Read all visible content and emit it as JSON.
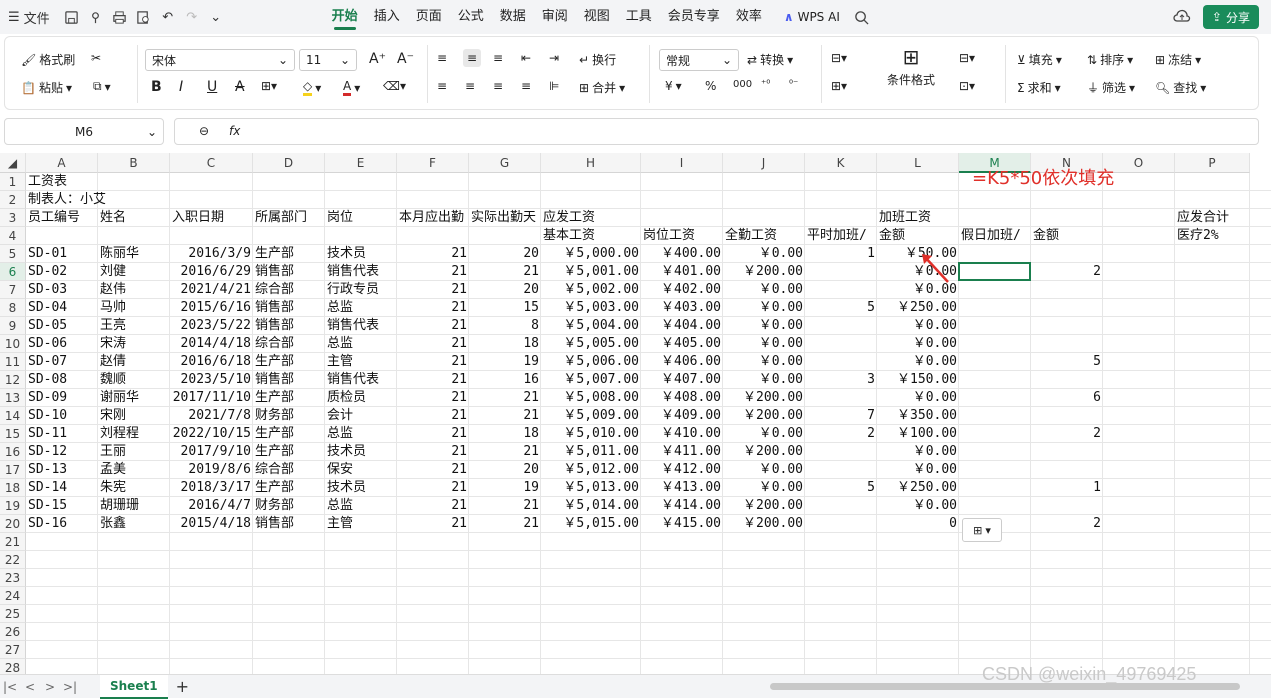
{
  "titlebar": {
    "file_label": "文件",
    "tabs": [
      "开始",
      "插入",
      "页面",
      "公式",
      "数据",
      "审阅",
      "视图",
      "工具",
      "会员专享",
      "效率"
    ],
    "wps_ai": "WPS AI",
    "share": "分享"
  },
  "ribbon": {
    "format_painter": "格式刷",
    "paste": "粘贴",
    "font_name": "宋体",
    "font_size": "11",
    "wrap": "换行",
    "merge": "合并",
    "number_format": "常规",
    "convert": "转换",
    "cond_format": "条件格式",
    "fill": "填充",
    "sort": "排序",
    "freeze": "冻结",
    "sum": "求和",
    "filter": "筛选",
    "find": "查找",
    "currency": "¥",
    "percent": "%",
    "thousands": "000"
  },
  "formula_bar": {
    "name_box": "M6",
    "fx": "fx",
    "formula": ""
  },
  "columns": [
    "A",
    "B",
    "C",
    "D",
    "E",
    "F",
    "G",
    "H",
    "I",
    "J",
    "K",
    "L",
    "M",
    "N",
    "O",
    "P"
  ],
  "rows": [
    "1",
    "2",
    "3",
    "4",
    "5",
    "6",
    "7",
    "8",
    "9",
    "10",
    "11",
    "12",
    "13",
    "14",
    "15",
    "16",
    "17",
    "18",
    "19",
    "20",
    "21",
    "22",
    "23",
    "24",
    "25",
    "26",
    "27",
    "28"
  ],
  "header": {
    "title": "工资表",
    "maker": "制表人：小艾",
    "h3": [
      "员工编号",
      "姓名",
      "入职日期",
      "所属部门",
      "岗位",
      "本月应出勤",
      "实际出勤天",
      "应发工资",
      "",
      "",
      "",
      "加班工资",
      "",
      "",
      "",
      "应发合计"
    ],
    "h4": {
      "H": "基本工资",
      "I": "岗位工资",
      "J": "全勤工资",
      "K": "平时加班/",
      "L": "金额",
      "M": "假日加班/",
      "N": "金额",
      "P": "医疗2%"
    }
  },
  "data_rows": [
    {
      "id": "SD-01",
      "name": "陈丽华",
      "date": "2016/3/9",
      "dept": "生产部",
      "post": "技术员",
      "due": "21",
      "actual": "20",
      "base": "￥5,000.00",
      "postpay": "￥400.00",
      "full": "￥0.00",
      "k": "1",
      "l": "￥50.00",
      "n": ""
    },
    {
      "id": "SD-02",
      "name": "刘健",
      "date": "2016/6/29",
      "dept": "销售部",
      "post": "销售代表",
      "due": "21",
      "actual": "21",
      "base": "￥5,001.00",
      "postpay": "￥401.00",
      "full": "￥200.00",
      "k": "",
      "l": "￥0.00",
      "n": "2"
    },
    {
      "id": "SD-03",
      "name": "赵伟",
      "date": "2021/4/21",
      "dept": "综合部",
      "post": "行政专员",
      "due": "21",
      "actual": "20",
      "base": "￥5,002.00",
      "postpay": "￥402.00",
      "full": "￥0.00",
      "k": "",
      "l": "￥0.00",
      "n": ""
    },
    {
      "id": "SD-04",
      "name": "马帅",
      "date": "2015/6/16",
      "dept": "销售部",
      "post": "总监",
      "due": "21",
      "actual": "15",
      "base": "￥5,003.00",
      "postpay": "￥403.00",
      "full": "￥0.00",
      "k": "5",
      "l": "￥250.00",
      "n": ""
    },
    {
      "id": "SD-05",
      "name": "王亮",
      "date": "2023/5/22",
      "dept": "销售部",
      "post": "销售代表",
      "due": "21",
      "actual": "8",
      "base": "￥5,004.00",
      "postpay": "￥404.00",
      "full": "￥0.00",
      "k": "",
      "l": "￥0.00",
      "n": ""
    },
    {
      "id": "SD-06",
      "name": "宋涛",
      "date": "2014/4/18",
      "dept": "综合部",
      "post": "总监",
      "due": "21",
      "actual": "18",
      "base": "￥5,005.00",
      "postpay": "￥405.00",
      "full": "￥0.00",
      "k": "",
      "l": "￥0.00",
      "n": ""
    },
    {
      "id": "SD-07",
      "name": "赵倩",
      "date": "2016/6/18",
      "dept": "生产部",
      "post": "主管",
      "due": "21",
      "actual": "19",
      "base": "￥5,006.00",
      "postpay": "￥406.00",
      "full": "￥0.00",
      "k": "",
      "l": "￥0.00",
      "n": "5"
    },
    {
      "id": "SD-08",
      "name": "魏顺",
      "date": "2023/5/10",
      "dept": "销售部",
      "post": "销售代表",
      "due": "21",
      "actual": "16",
      "base": "￥5,007.00",
      "postpay": "￥407.00",
      "full": "￥0.00",
      "k": "3",
      "l": "￥150.00",
      "n": ""
    },
    {
      "id": "SD-09",
      "name": "谢丽华",
      "date": "2017/11/10",
      "dept": "生产部",
      "post": "质检员",
      "due": "21",
      "actual": "21",
      "base": "￥5,008.00",
      "postpay": "￥408.00",
      "full": "￥200.00",
      "k": "",
      "l": "￥0.00",
      "n": "6"
    },
    {
      "id": "SD-10",
      "name": "宋刚",
      "date": "2021/7/8",
      "dept": "财务部",
      "post": "会计",
      "due": "21",
      "actual": "21",
      "base": "￥5,009.00",
      "postpay": "￥409.00",
      "full": "￥200.00",
      "k": "7",
      "l": "￥350.00",
      "n": ""
    },
    {
      "id": "SD-11",
      "name": "刘程程",
      "date": "2022/10/15",
      "dept": "生产部",
      "post": "总监",
      "due": "21",
      "actual": "18",
      "base": "￥5,010.00",
      "postpay": "￥410.00",
      "full": "￥0.00",
      "k": "2",
      "l": "￥100.00",
      "n": "2"
    },
    {
      "id": "SD-12",
      "name": "王丽",
      "date": "2017/9/10",
      "dept": "生产部",
      "post": "技术员",
      "due": "21",
      "actual": "21",
      "base": "￥5,011.00",
      "postpay": "￥411.00",
      "full": "￥200.00",
      "k": "",
      "l": "￥0.00",
      "n": ""
    },
    {
      "id": "SD-13",
      "name": "孟美",
      "date": "2019/8/6",
      "dept": "综合部",
      "post": "保安",
      "due": "21",
      "actual": "20",
      "base": "￥5,012.00",
      "postpay": "￥412.00",
      "full": "￥0.00",
      "k": "",
      "l": "￥0.00",
      "n": ""
    },
    {
      "id": "SD-14",
      "name": "朱宪",
      "date": "2018/3/17",
      "dept": "生产部",
      "post": "技术员",
      "due": "21",
      "actual": "19",
      "base": "￥5,013.00",
      "postpay": "￥413.00",
      "full": "￥0.00",
      "k": "5",
      "l": "￥250.00",
      "n": "1"
    },
    {
      "id": "SD-15",
      "name": "胡珊珊",
      "date": "2016/4/7",
      "dept": "财务部",
      "post": "总监",
      "due": "21",
      "actual": "21",
      "base": "￥5,014.00",
      "postpay": "￥414.00",
      "full": "￥200.00",
      "k": "",
      "l": "￥0.00",
      "n": ""
    },
    {
      "id": "SD-16",
      "name": "张鑫",
      "date": "2015/4/18",
      "dept": "销售部",
      "post": "主管",
      "due": "21",
      "actual": "21",
      "base": "￥5,015.00",
      "postpay": "￥415.00",
      "full": "￥200.00",
      "k": "",
      "l": "0",
      "n": "2"
    }
  ],
  "annotation": "=K5*50依次填充",
  "sheet_tab": "Sheet1",
  "watermark": "CSDN @weixin_49769425",
  "colors": {
    "accent": "#1a7f4e",
    "annotation": "#e0302a"
  }
}
